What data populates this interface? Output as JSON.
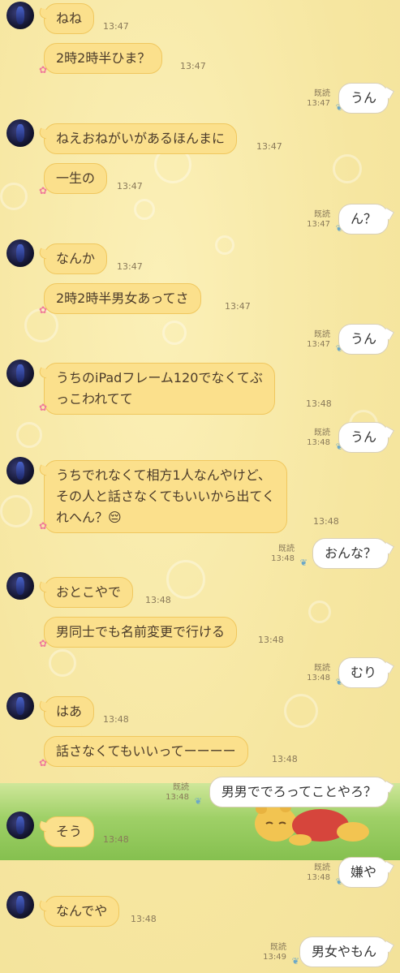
{
  "messages": [
    {
      "side": "left",
      "text": "ねね",
      "time": "13:47",
      "avatar": true
    },
    {
      "side": "left",
      "text": "2時2時半ひま？",
      "time": "13:47"
    },
    {
      "side": "right",
      "text": "うん",
      "time": "13:47",
      "read": "既読"
    },
    {
      "side": "left",
      "text": "ねえおねがいがあるほんまに",
      "time": "13:47",
      "avatar": true
    },
    {
      "side": "left",
      "text": "一生の",
      "time": "13:47"
    },
    {
      "side": "right",
      "text": "ん？",
      "time": "13:47",
      "read": "既読"
    },
    {
      "side": "left",
      "text": "なんか",
      "time": "13:47",
      "avatar": true
    },
    {
      "side": "left",
      "text": "2時2時半男女あってさ",
      "time": "13:47"
    },
    {
      "side": "right",
      "text": "うん",
      "time": "13:47",
      "read": "既読"
    },
    {
      "side": "left",
      "text_lines": [
        "うちのiPadフレーム120でなくてぶ",
        "っこわれてて"
      ],
      "time": "13:48",
      "avatar": true
    },
    {
      "side": "right",
      "text": "うん",
      "time": "13:48",
      "read": "既読"
    },
    {
      "side": "left",
      "text_lines": [
        "うちでれなくて相方1人なんやけど、",
        "その人と話さなくてもいいから出てく",
        "れへん？😔"
      ],
      "time": "13:48",
      "avatar": true
    },
    {
      "side": "right",
      "text": "おんな？",
      "time": "13:48",
      "read": "既読"
    },
    {
      "side": "left",
      "text": "おとこやで",
      "time": "13:48",
      "avatar": true
    },
    {
      "side": "left",
      "text": "男同士でも名前変更で行ける",
      "time": "13:48"
    },
    {
      "side": "right",
      "text": "むり",
      "time": "13:48",
      "read": "既読"
    },
    {
      "side": "left",
      "text": "はあ",
      "time": "13:48",
      "avatar": true
    },
    {
      "side": "left",
      "text": "話さなくてもいいってーーーー",
      "time": "13:48"
    },
    {
      "side": "right",
      "text": "男男ででろってことやろ？",
      "time": "13:48",
      "read": "既読"
    },
    {
      "side": "left",
      "text": "そう",
      "time": "13:48",
      "avatar": true
    },
    {
      "side": "right",
      "text": "嫌や",
      "time": "13:48",
      "read": "既読"
    },
    {
      "side": "left",
      "text": "なんでや",
      "time": "13:48",
      "avatar": true
    },
    {
      "side": "right",
      "text": "男女やもん",
      "time": "13:49",
      "read": "既読"
    }
  ]
}
